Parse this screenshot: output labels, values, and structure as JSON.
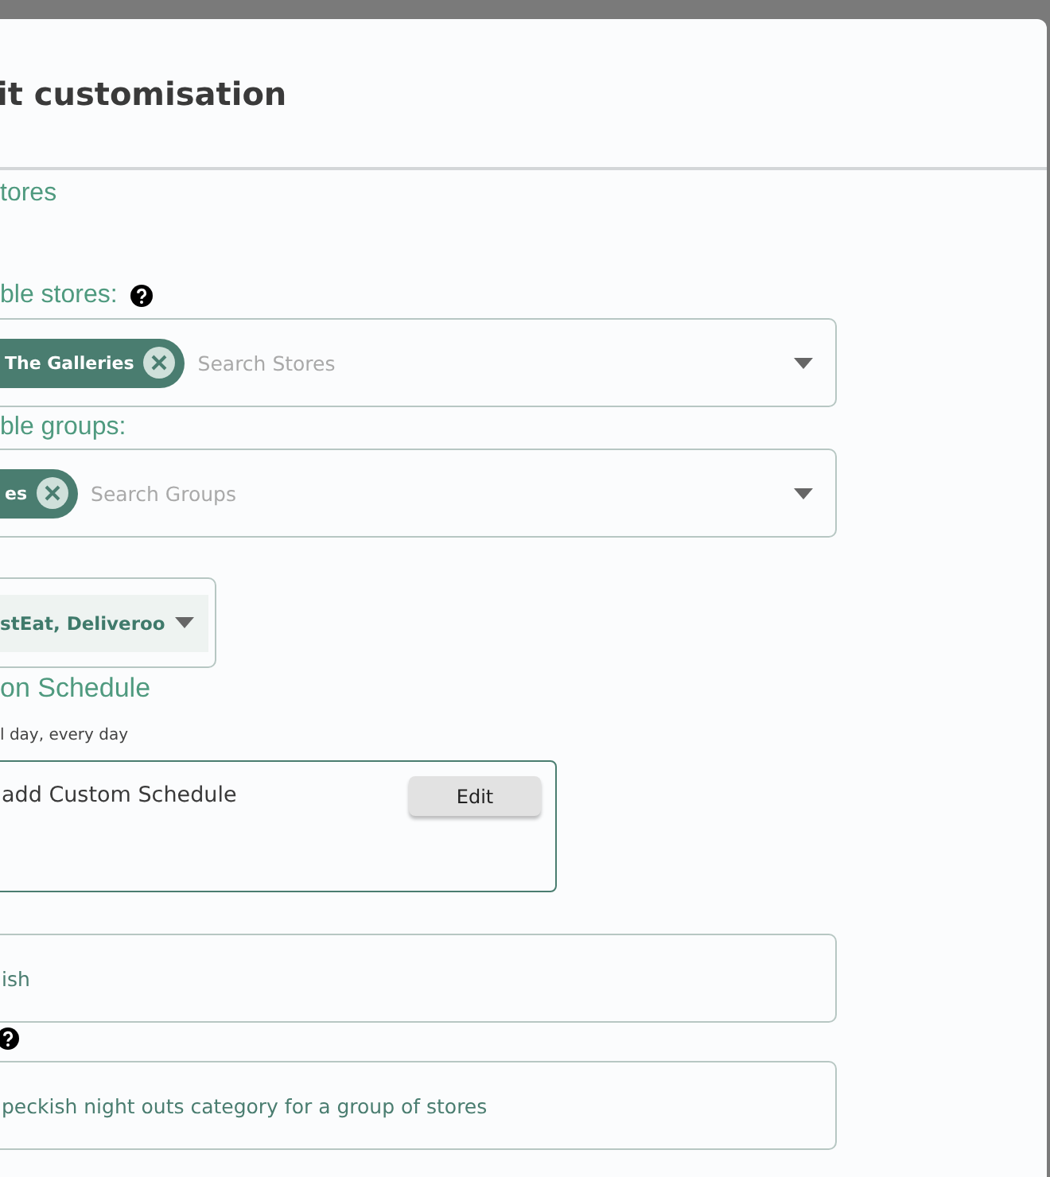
{
  "title": "it customisation",
  "section": "tores",
  "stores": {
    "label": "ble stores:",
    "chips": [
      "The Galleries"
    ],
    "placeholder": "Search Stores"
  },
  "groups": {
    "label": "ble groups:",
    "chips": [
      "es"
    ],
    "placeholder": "Search Groups"
  },
  "delivery": {
    "value": "stEat, Deliveroo"
  },
  "schedule": {
    "heading": "on Schedule",
    "summary": "l day, every day",
    "custom_label": "add Custom Schedule",
    "button": "Edit"
  },
  "name_field": {
    "value": "ish"
  },
  "description_field": {
    "value": "peckish night outs category for a group of stores"
  }
}
